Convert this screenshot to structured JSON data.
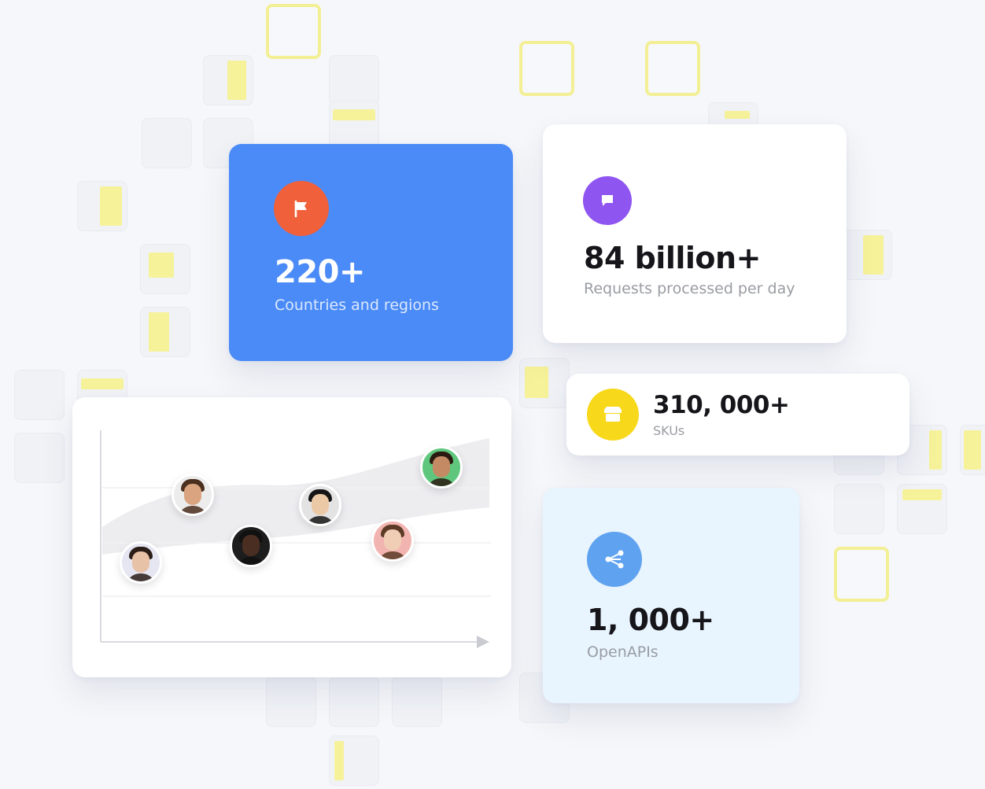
{
  "stats": {
    "countries": {
      "value": "220+",
      "label": "Countries and regions",
      "icon": "flag-icon",
      "icon_color": "#f0603a",
      "card_color": "#4b8bf7"
    },
    "requests": {
      "value": "84 billion+",
      "label": "Requests processed per day",
      "icon": "chat-bubble-icon",
      "icon_color": "#8f55f0"
    },
    "skus": {
      "value": "310, 000+",
      "label": "SKUs",
      "icon": "store-icon",
      "icon_color": "#f7d81a"
    },
    "apis": {
      "value": "1, 000+",
      "label": "OpenAPIs",
      "icon": "share-nodes-icon",
      "icon_color": "#5ea2f0",
      "card_color": "#e8f4fe"
    }
  },
  "chart": {
    "avatars": [
      {
        "name": "avatar-woman-1",
        "bg": "#e6e6f2",
        "skin": "#e8c2a6",
        "hair": "#2a1c16"
      },
      {
        "name": "avatar-man-curly",
        "bg": "#ececec",
        "skin": "#d9a47f",
        "hair": "#4a2e1e"
      },
      {
        "name": "avatar-man-dark",
        "bg": "#1d1d1d",
        "skin": "#4b2e22",
        "hair": "#111111"
      },
      {
        "name": "avatar-man-asian",
        "bg": "#e3e3e3",
        "skin": "#ecc9a6",
        "hair": "#151515"
      },
      {
        "name": "avatar-woman-2",
        "bg": "#f2b4b0",
        "skin": "#f0cdb5",
        "hair": "#5b3a26"
      },
      {
        "name": "avatar-man-green",
        "bg": "#5fc77d",
        "skin": "#c48a64",
        "hair": "#2a1a10"
      }
    ]
  }
}
